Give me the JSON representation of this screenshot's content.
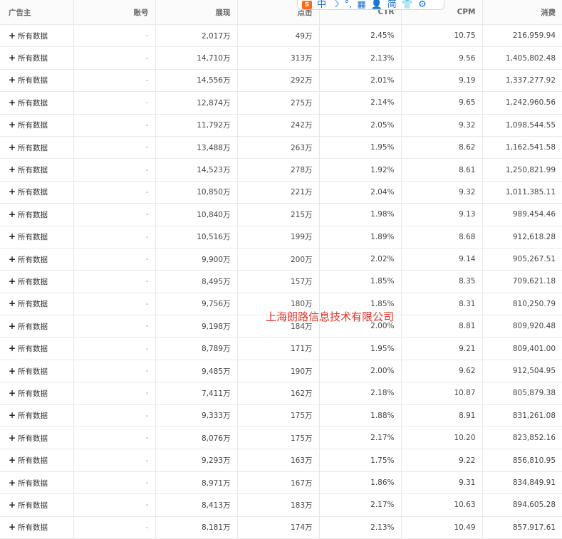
{
  "columns": [
    "广告主",
    "账号",
    "展现",
    "点击",
    "CTR",
    "CPM",
    "消费"
  ],
  "row_label": "所有数据",
  "rows": [
    {
      "account": "-",
      "impressions": "2,017万",
      "clicks": "49万",
      "ctr": "2.45%",
      "cpm": "10.75",
      "spend": "216,959.94"
    },
    {
      "account": "-",
      "impressions": "14,710万",
      "clicks": "313万",
      "ctr": "2.13%",
      "cpm": "9.56",
      "spend": "1,405,802.48"
    },
    {
      "account": "-",
      "impressions": "14,556万",
      "clicks": "292万",
      "ctr": "2.01%",
      "cpm": "9.19",
      "spend": "1,337,277.92"
    },
    {
      "account": "-",
      "impressions": "12,874万",
      "clicks": "275万",
      "ctr": "2.14%",
      "cpm": "9.65",
      "spend": "1,242,960.56"
    },
    {
      "account": "-",
      "impressions": "11,792万",
      "clicks": "242万",
      "ctr": "2.05%",
      "cpm": "9.32",
      "spend": "1,098,544.55"
    },
    {
      "account": "-",
      "impressions": "13,488万",
      "clicks": "263万",
      "ctr": "1.95%",
      "cpm": "8.62",
      "spend": "1,162,541.58"
    },
    {
      "account": "-",
      "impressions": "14,523万",
      "clicks": "278万",
      "ctr": "1.92%",
      "cpm": "8.61",
      "spend": "1,250,821.99"
    },
    {
      "account": "-",
      "impressions": "10,850万",
      "clicks": "221万",
      "ctr": "2.04%",
      "cpm": "9.32",
      "spend": "1,011,385.11"
    },
    {
      "account": "-",
      "impressions": "10,840万",
      "clicks": "215万",
      "ctr": "1.98%",
      "cpm": "9.13",
      "spend": "989,454.46"
    },
    {
      "account": "-",
      "impressions": "10,516万",
      "clicks": "199万",
      "ctr": "1.89%",
      "cpm": "8.68",
      "spend": "912,618.28"
    },
    {
      "account": "-",
      "impressions": "9,900万",
      "clicks": "200万",
      "ctr": "2.02%",
      "cpm": "9.14",
      "spend": "905,267.51"
    },
    {
      "account": "-",
      "impressions": "8,495万",
      "clicks": "157万",
      "ctr": "1.85%",
      "cpm": "8.35",
      "spend": "709,621.18"
    },
    {
      "account": "-",
      "impressions": "9,756万",
      "clicks": "180万",
      "ctr": "1.85%",
      "cpm": "8.31",
      "spend": "810,250.79"
    },
    {
      "account": "-",
      "impressions": "9,198万",
      "clicks": "184万",
      "ctr": "2.00%",
      "cpm": "8.81",
      "spend": "809,920.48"
    },
    {
      "account": "-",
      "impressions": "8,789万",
      "clicks": "171万",
      "ctr": "1.95%",
      "cpm": "9.21",
      "spend": "809,401.00"
    },
    {
      "account": "-",
      "impressions": "9,485万",
      "clicks": "190万",
      "ctr": "2.00%",
      "cpm": "9.62",
      "spend": "912,504.95"
    },
    {
      "account": "-",
      "impressions": "7,411万",
      "clicks": "162万",
      "ctr": "2.18%",
      "cpm": "10.87",
      "spend": "805,879.38"
    },
    {
      "account": "-",
      "impressions": "9,333万",
      "clicks": "175万",
      "ctr": "1.88%",
      "cpm": "8.91",
      "spend": "831,261.08"
    },
    {
      "account": "-",
      "impressions": "8,076万",
      "clicks": "175万",
      "ctr": "2.17%",
      "cpm": "10.20",
      "spend": "823,852.16"
    },
    {
      "account": "-",
      "impressions": "9,293万",
      "clicks": "163万",
      "ctr": "1.75%",
      "cpm": "9.22",
      "spend": "856,810.95"
    },
    {
      "account": "-",
      "impressions": "8,971万",
      "clicks": "167万",
      "ctr": "1.86%",
      "cpm": "9.31",
      "spend": "834,849.91"
    },
    {
      "account": "-",
      "impressions": "8,413万",
      "clicks": "183万",
      "ctr": "2.17%",
      "cpm": "10.63",
      "spend": "894,605.28"
    },
    {
      "account": "-",
      "impressions": "8,181万",
      "clicks": "174万",
      "ctr": "2.13%",
      "cpm": "10.49",
      "spend": "857,917.61"
    }
  ],
  "ime_toolbar": {
    "logo_icon": "sogou-s-logo",
    "mode_label": "中",
    "icons": [
      "moon-icon",
      "punctuation-icon",
      "keyboard-icon",
      "user-icon",
      "skin-icon",
      "gear-icon"
    ],
    "fullwidth_label": "简"
  },
  "watermark": "上海朗路信息技术有限公司"
}
